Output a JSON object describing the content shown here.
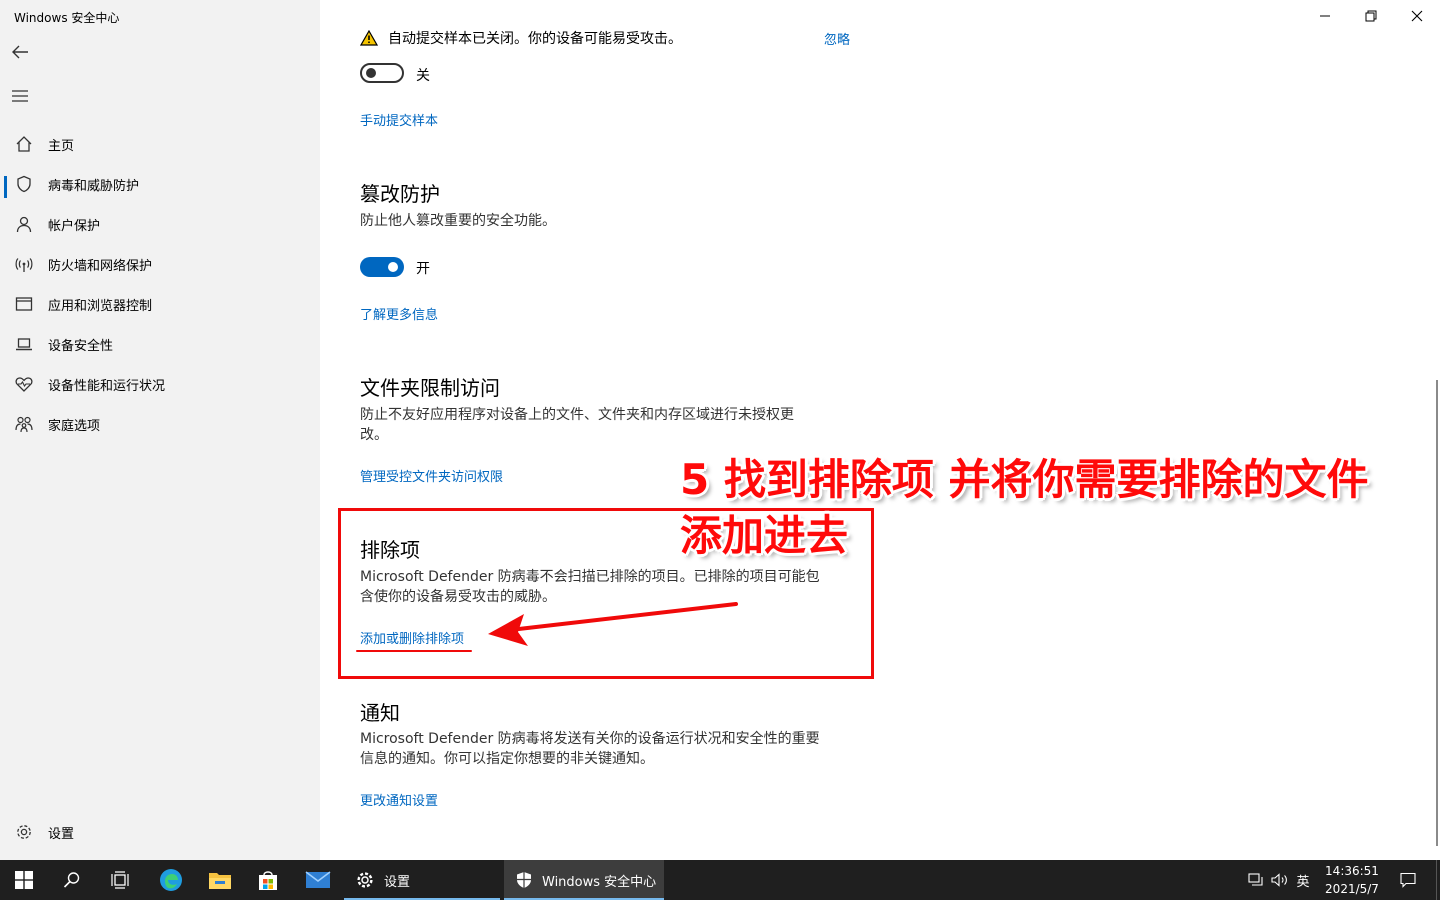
{
  "window": {
    "title": "Windows 安全中心"
  },
  "sidebar": {
    "items": [
      {
        "label": "主页",
        "icon": "home-icon"
      },
      {
        "label": "病毒和威胁防护",
        "icon": "shield-icon"
      },
      {
        "label": "帐户保护",
        "icon": "person-icon"
      },
      {
        "label": "防火墙和网络保护",
        "icon": "wifi-icon"
      },
      {
        "label": "应用和浏览器控制",
        "icon": "browser-window-icon"
      },
      {
        "label": "设备安全性",
        "icon": "laptop-icon"
      },
      {
        "label": "设备性能和运行状况",
        "icon": "heart-icon"
      },
      {
        "label": "家庭选项",
        "icon": "family-icon"
      }
    ],
    "settings_label": "设置"
  },
  "main": {
    "warning": {
      "text": "自动提交样本已关闭。你的设备可能易受攻击。",
      "ignore": "忽略"
    },
    "sample_toggle": {
      "state": "关"
    },
    "manual_submit_link": "手动提交样本",
    "tamper": {
      "title": "篡改防护",
      "desc": "防止他人篡改重要的安全功能。",
      "toggle_state": "开",
      "link": "了解更多信息"
    },
    "folder_access": {
      "title": "文件夹限制访问",
      "desc_line1": "防止不友好应用程序对设备上的文件、文件夹和内存区域进行未授权更",
      "desc_line2": "改。",
      "link": "管理受控文件夹访问权限"
    },
    "exclusions": {
      "title": "排除项",
      "desc_line1": "Microsoft Defender 防病毒不会扫描已排除的项目。已排除的项目可能包",
      "desc_line2": "含使你的设备易受攻击的威胁。",
      "link": "添加或删除排除项"
    },
    "notifications": {
      "title": "通知",
      "desc_line1": "Microsoft Defender 防病毒将发送有关你的设备运行状况和安全性的重要",
      "desc_line2": "信息的通知。你可以指定你想要的非关键通知。",
      "link": "更改通知设置"
    }
  },
  "annotation": {
    "line1": "5  找到排除项  并将你需要排除的文件",
    "line2": "添加进去",
    "color": "#ff0a0a"
  },
  "taskbar": {
    "settings_app": "设置",
    "security_app": "Windows 安全中心",
    "ime": "英",
    "time": "14:36:51",
    "date": "2021/5/7"
  }
}
